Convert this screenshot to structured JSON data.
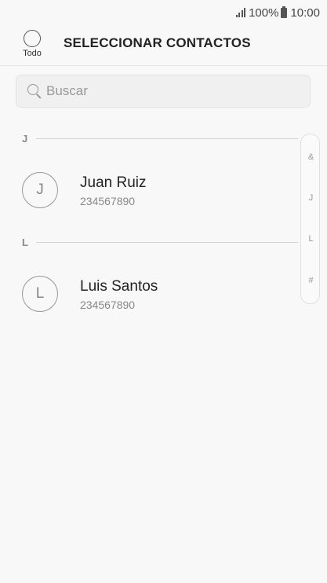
{
  "status_bar": {
    "battery": "100%",
    "time": "10:00"
  },
  "header": {
    "select_all_label": "Todo",
    "title": "SELECCIONAR CONTACTOS"
  },
  "search": {
    "placeholder": "Buscar"
  },
  "sections": [
    {
      "letter": "J",
      "contacts": [
        {
          "initial": "J",
          "name": "Juan Ruiz",
          "phone": "234567890"
        }
      ]
    },
    {
      "letter": "L",
      "contacts": [
        {
          "initial": "L",
          "name": "Luis Santos",
          "phone": "234567890"
        }
      ]
    }
  ],
  "index_bar": [
    "&",
    "J",
    "L",
    "#"
  ]
}
